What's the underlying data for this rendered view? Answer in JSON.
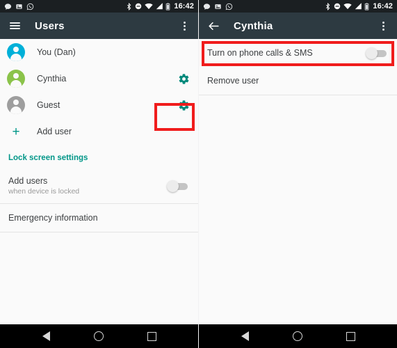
{
  "theme": {
    "appbar_bg": "#2d3a41",
    "statusbar_bg": "#1b1f22",
    "accent_teal": "#009688",
    "highlight_red": "#f01c1c",
    "content_bg": "#fafafa",
    "avatar_you": "#00b0d8",
    "avatar_cynthia": "#8bc34a",
    "avatar_guest": "#9e9e9e"
  },
  "left_screen": {
    "status_bar": {
      "clock": "16:42",
      "notification_icons": [
        "message-bubble-icon",
        "image-icon",
        "whatsapp-icon"
      ],
      "system_icons": [
        "bluetooth-icon",
        "do-not-disturb-icon",
        "wifi-icon",
        "signal-icon",
        "battery-icon"
      ]
    },
    "app_bar": {
      "nav_icon": "hamburger-menu-icon",
      "title": "Users",
      "overflow_icon": "overflow-menu-icon"
    },
    "users": [
      {
        "name": "You (Dan)",
        "avatar_color": "#00b0d8",
        "has_gear": false,
        "highlighted": false
      },
      {
        "name": "Cynthia",
        "avatar_color": "#8bc34a",
        "has_gear": true,
        "highlighted": true
      },
      {
        "name": "Guest",
        "avatar_color": "#9e9e9e",
        "has_gear": true,
        "highlighted": false
      }
    ],
    "add_user": {
      "label": "Add user",
      "icon": "plus-icon"
    },
    "lock_screen_settings": {
      "label": "Lock screen settings"
    },
    "add_users_pref": {
      "title": "Add users",
      "subtitle": "when device is locked",
      "toggle_state": "off"
    },
    "emergency_information": {
      "label": "Emergency information"
    }
  },
  "right_screen": {
    "status_bar": {
      "clock": "16:42",
      "notification_icons": [
        "message-bubble-icon",
        "image-icon",
        "whatsapp-icon"
      ],
      "system_icons": [
        "bluetooth-icon",
        "do-not-disturb-icon",
        "wifi-icon",
        "signal-icon",
        "battery-icon"
      ]
    },
    "app_bar": {
      "nav_icon": "back-arrow-icon",
      "title": "Cynthia",
      "overflow_icon": "overflow-menu-icon"
    },
    "phone_calls_pref": {
      "title": "Turn on phone calls & SMS",
      "toggle_state": "off",
      "highlighted": true
    },
    "remove_user": {
      "label": "Remove user"
    }
  },
  "nav_bar": {
    "back": "back-triangle-icon",
    "home": "home-circle-icon",
    "recents": "recents-square-icon"
  }
}
